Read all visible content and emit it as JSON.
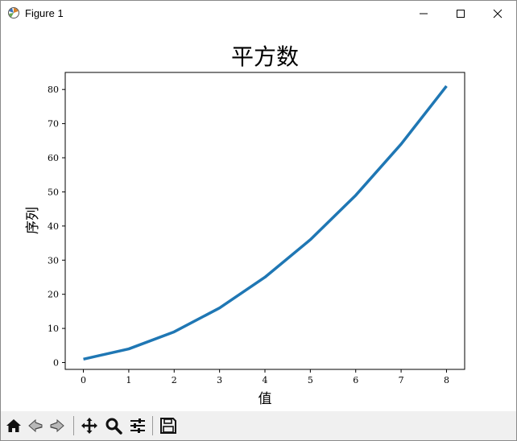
{
  "window": {
    "title": "Figure 1"
  },
  "toolbar": {
    "buttons": [
      {
        "name": "home-icon"
      },
      {
        "name": "back-icon"
      },
      {
        "name": "forward-icon"
      },
      {
        "name": "pan-icon"
      },
      {
        "name": "zoom-icon"
      },
      {
        "name": "configure-subplots-icon"
      },
      {
        "name": "save-icon"
      }
    ]
  },
  "chart_data": {
    "type": "line",
    "title": "平方数",
    "xlabel": "值",
    "ylabel": "序列",
    "x": [
      0,
      1,
      2,
      3,
      4,
      5,
      6,
      7,
      8
    ],
    "series": [
      {
        "values": [
          1,
          4,
          9,
          16,
          25,
          36,
          49,
          64,
          81
        ],
        "color": "#1f77b4"
      }
    ],
    "xlim": [
      -0.4,
      8.4
    ],
    "ylim": [
      -2.0,
      85.0
    ],
    "xticks": [
      0,
      1,
      2,
      3,
      4,
      5,
      6,
      7,
      8
    ],
    "yticks": [
      0,
      10,
      20,
      30,
      40,
      50,
      60,
      70,
      80
    ],
    "grid": false,
    "legend": "none"
  }
}
